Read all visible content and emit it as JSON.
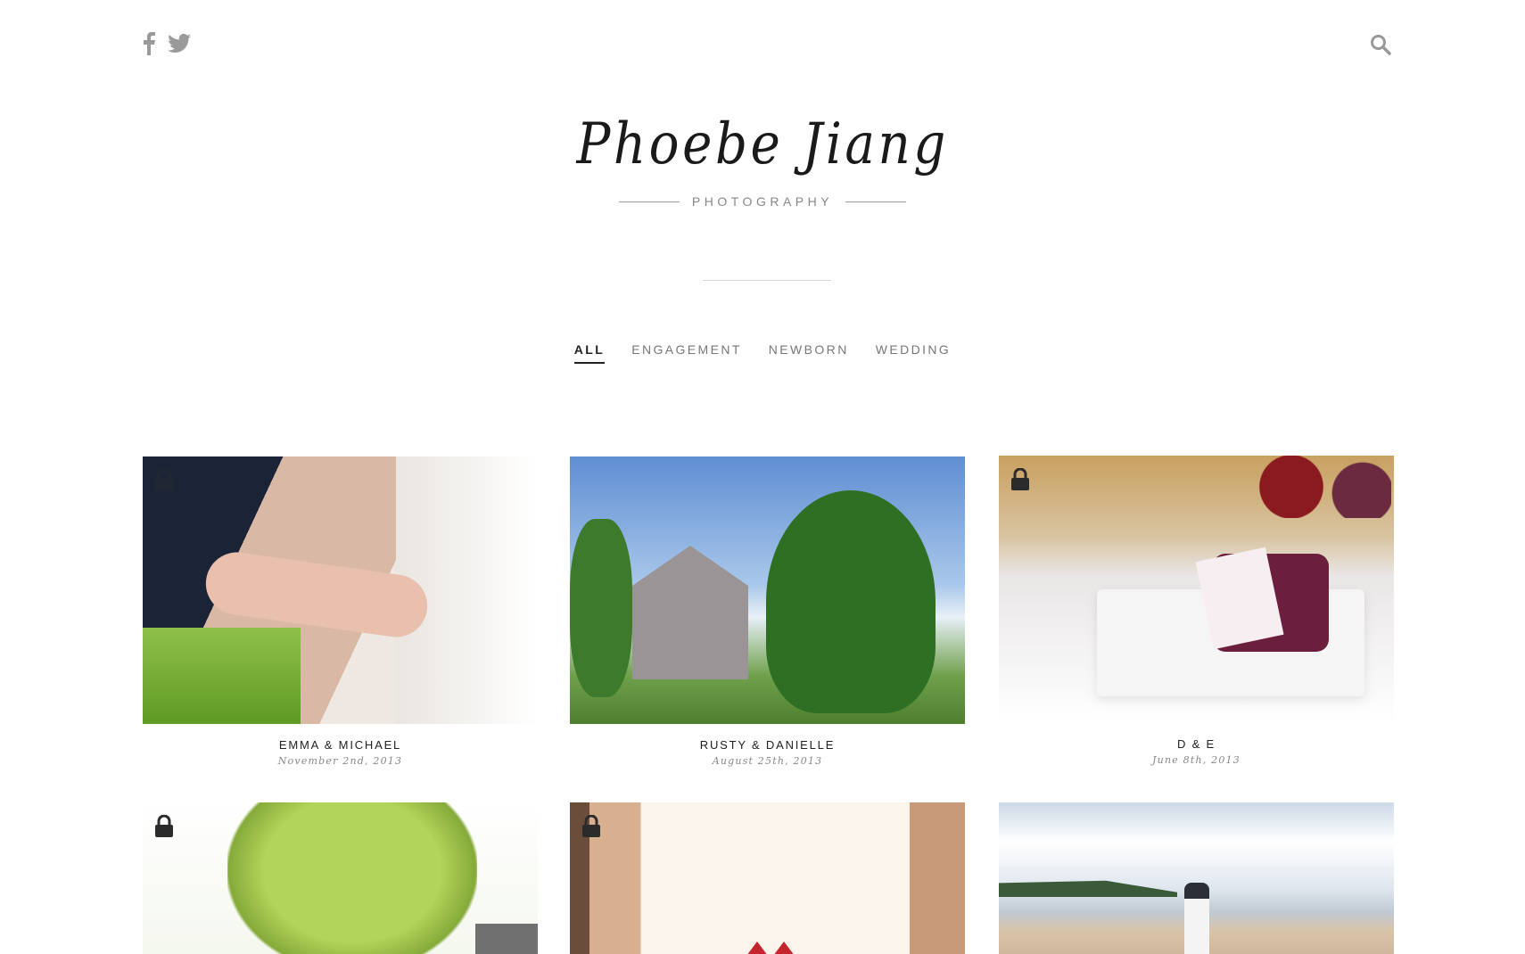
{
  "social": {
    "facebook_icon": "facebook-icon",
    "twitter_icon": "twitter-icon"
  },
  "search_icon": "search-icon",
  "logo": {
    "name": "Phoebe Jiang",
    "subtitle": "PHOTOGRAPHY"
  },
  "filters": [
    {
      "label": "ALL",
      "active": true
    },
    {
      "label": "ENGAGEMENT",
      "active": false
    },
    {
      "label": "NEWBORN",
      "active": false
    },
    {
      "label": "WEDDING",
      "active": false
    }
  ],
  "galleries": [
    {
      "title": "EMMA & MICHAEL",
      "date": "November 2nd, 2013",
      "locked": true
    },
    {
      "title": "RUSTY & DANIELLE",
      "date": "August 25th, 2013",
      "locked": false
    },
    {
      "title": "D & E",
      "date": "June 8th, 2013",
      "locked": true
    },
    {
      "title": "",
      "date": "",
      "locked": true
    },
    {
      "title": "",
      "date": "",
      "locked": true
    },
    {
      "title": "",
      "date": "",
      "locked": false
    }
  ],
  "colors": {
    "accent": "#222222",
    "muted": "#888888",
    "divider": "#d8d8d8"
  }
}
